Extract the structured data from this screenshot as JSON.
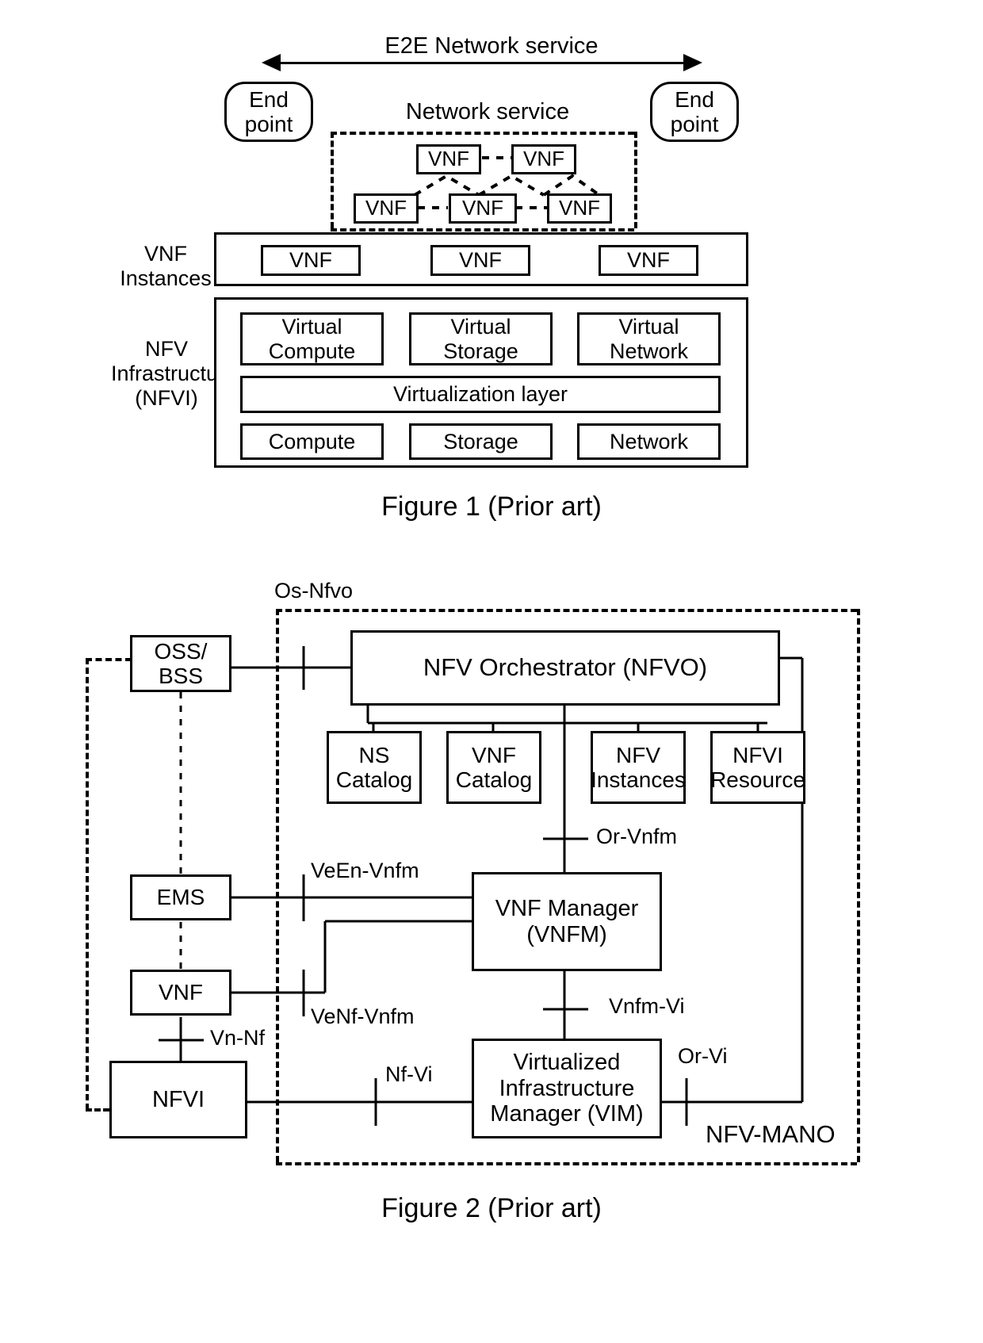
{
  "figure1": {
    "caption": "Figure 1 (Prior art)",
    "e2e_label": "E2E Network service",
    "network_service_label": "Network service",
    "endpoint_left": "End\npoint",
    "endpoint_right": "End\npoint",
    "ns_vnfs_top": [
      "VNF",
      "VNF"
    ],
    "ns_vnfs_bottom": [
      "VNF",
      "VNF",
      "VNF"
    ],
    "vnf_instances_side_label": "VNF\nInstances",
    "vnf_instances": [
      "VNF",
      "VNF",
      "VNF"
    ],
    "nfvi_side_label": "NFV\nInfrastructure\n(NFVI)",
    "virtual_resources": [
      "Virtual\nCompute",
      "Virtual\nStorage",
      "Virtual\nNetwork"
    ],
    "virtualization_layer": "Virtualization layer",
    "hardware_resources": [
      "Compute",
      "Storage",
      "Network"
    ]
  },
  "figure2": {
    "caption": "Figure 2 (Prior art)",
    "mano_boundary_label": "NFV-MANO",
    "os_nfvo_label": "Os-Nfvo",
    "oss_bss": "OSS/\nBSS",
    "nfvo": "NFV Orchestrator (NFVO)",
    "repositories": [
      "NS\nCatalog",
      "VNF\nCatalog",
      "NFV\nInstances",
      "NFVI\nResource"
    ],
    "ems": "EMS",
    "vnf": "VNF",
    "nfvi": "NFVI",
    "vnfm": "VNF Manager\n(VNFM)",
    "vim": "Virtualized\nInfrastructure\nManager (VIM)",
    "reference_points": {
      "or_vnfm": "Or-Vnfm",
      "veen_vnfm": "VeEn-Vnfm",
      "venf_vnfm": "VeNf-Vnfm",
      "vn_nf": "Vn-Nf",
      "vnfm_vi": "Vnfm-Vi",
      "nf_vi": "Nf-Vi",
      "or_vi": "Or-Vi"
    }
  },
  "colors": {
    "stroke": "#000000",
    "background": "#ffffff"
  }
}
